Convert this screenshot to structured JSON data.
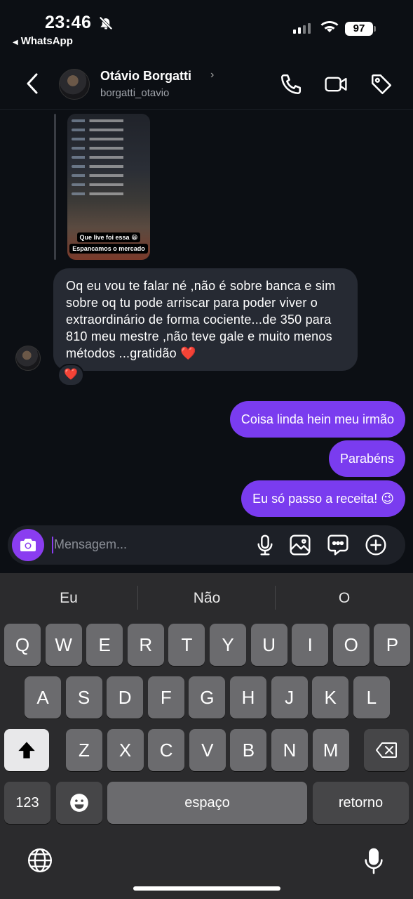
{
  "status_bar": {
    "time": "23:46",
    "back_app": "WhatsApp",
    "battery": "97"
  },
  "header": {
    "name": "Otávio Borgatti",
    "username": "borgatti_otavio"
  },
  "shared_post": {
    "caption_line1": "Que live foi essa 😁",
    "caption_line2": "Espancamos o mercado"
  },
  "incoming_message": {
    "text": "Oq eu vou te falar né ,não é sobre banca e sim sobre oq tu pode arriscar para poder viver o extraordinário de forma cociente...de 350 para 810 meu mestre ,não teve gale e muito menos métodos ...gratidão ❤️",
    "reaction": "❤️"
  },
  "outgoing_messages": [
    {
      "text": "Coisa linda hein meu irmão"
    },
    {
      "text": "Parabéns"
    },
    {
      "text": "Eu só passo a receita! 😉"
    }
  ],
  "composer": {
    "placeholder": "Mensagem..."
  },
  "keyboard": {
    "suggestions": [
      "Eu",
      "Não",
      "O"
    ],
    "row1": [
      "Q",
      "W",
      "E",
      "R",
      "T",
      "Y",
      "U",
      "I",
      "O",
      "P"
    ],
    "row2": [
      "A",
      "S",
      "D",
      "F",
      "G",
      "H",
      "J",
      "K",
      "L"
    ],
    "row3": [
      "Z",
      "X",
      "C",
      "V",
      "B",
      "N",
      "M"
    ],
    "numbers_key": "123",
    "space_key": "espaço",
    "return_key": "retorno"
  },
  "colors": {
    "accent": "#7a3cef",
    "bubble_in": "#262a33",
    "background": "#0c0f14"
  }
}
